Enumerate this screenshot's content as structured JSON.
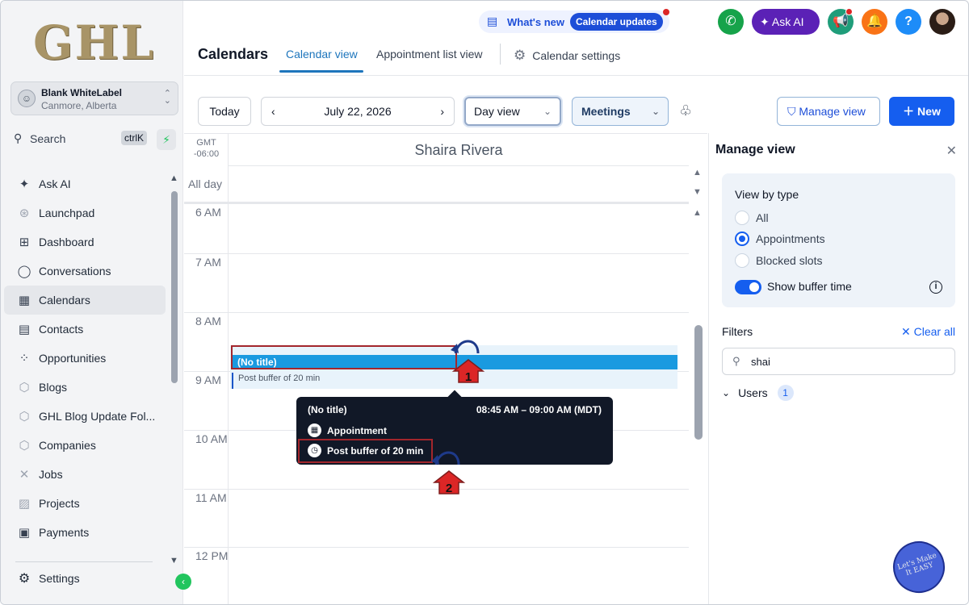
{
  "sidebar": {
    "logo": "GHL",
    "account": {
      "name": "Blank WhiteLabel",
      "location": "Canmore, Alberta"
    },
    "search": {
      "label": "Search",
      "shortcut": "ctrlK"
    },
    "items": [
      {
        "label": "Ask AI",
        "icon": "sparkle-icon"
      },
      {
        "label": "Launchpad",
        "icon": "rocket-icon"
      },
      {
        "label": "Dashboard",
        "icon": "grid-icon"
      },
      {
        "label": "Conversations",
        "icon": "chat-icon"
      },
      {
        "label": "Calendars",
        "icon": "calendar-icon",
        "active": true
      },
      {
        "label": "Contacts",
        "icon": "contacts-icon"
      },
      {
        "label": "Opportunities",
        "icon": "funnel-icon"
      },
      {
        "label": "Blogs",
        "icon": "blog-icon"
      },
      {
        "label": "GHL Blog Update Fol...",
        "icon": "folder-icon"
      },
      {
        "label": "Companies",
        "icon": "building-icon"
      },
      {
        "label": "Jobs",
        "icon": "tools-icon"
      },
      {
        "label": "Projects",
        "icon": "projects-icon"
      },
      {
        "label": "Payments",
        "icon": "payments-icon"
      }
    ],
    "settings_label": "Settings"
  },
  "header": {
    "whats_new": "What's new",
    "calendar_updates": "Calendar updates",
    "ask_ai": "Ask AI",
    "title": "Calendars",
    "tabs": [
      {
        "label": "Calendar view",
        "active": true
      },
      {
        "label": "Appointment list view"
      },
      {
        "label": "Calendar settings"
      }
    ]
  },
  "toolbar": {
    "today": "Today",
    "date": "July 22, 2026",
    "view": "Day view",
    "calendar_filter": "Meetings",
    "manage_view": "Manage view",
    "new": "New"
  },
  "calendar": {
    "timezone_line1": "GMT",
    "timezone_line2": "-06:00",
    "person": "Shaira Rivera",
    "all_day": "All day",
    "hours": [
      "6 AM",
      "7 AM",
      "8 AM",
      "9 AM",
      "10 AM",
      "11 AM",
      "12 PM"
    ],
    "event": {
      "title": "(No title)",
      "buffer": "Post buffer of 20 min"
    },
    "tooltip": {
      "title": "(No title)",
      "time": "08:45 AM – 09:00 AM (MDT)",
      "type": "Appointment",
      "buffer": "Post buffer of 20 min"
    },
    "markers": [
      "1",
      "2"
    ]
  },
  "manage_view": {
    "title": "Manage view",
    "view_by_type": "View by type",
    "options": [
      "All",
      "Appointments",
      "Blocked slots"
    ],
    "selected": "Appointments",
    "show_buffer": "Show buffer time",
    "show_buffer_on": true,
    "filters": "Filters",
    "clear_all": "Clear all",
    "search_value": "shai",
    "users_label": "Users",
    "users_count": "1"
  },
  "watermark": "Let's Make It EASY",
  "colors": {
    "accent": "#155eef",
    "event": "#1a9ae0",
    "highlight": "#a3262c",
    "askai": "#5b21b6"
  }
}
